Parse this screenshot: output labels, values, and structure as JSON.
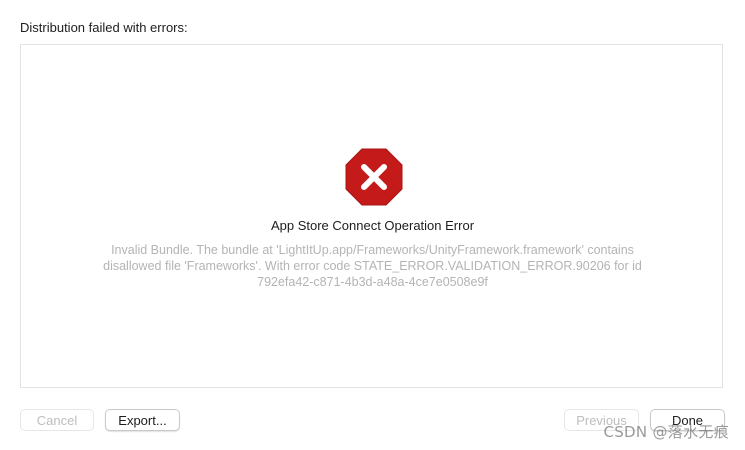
{
  "header": {
    "label": "Distribution failed with errors:"
  },
  "error": {
    "icon": "error-octagon-icon",
    "icon_color": "#c41a1a",
    "title": "App Store Connect Operation Error",
    "message": "Invalid Bundle. The bundle at 'LightItUp.app/Frameworks/UnityFramework.framework' contains disallowed file 'Frameworks'. With error code STATE_ERROR.VALIDATION_ERROR.90206 for id 792efa42-c871-4b3d-a48a-4ce7e0508e9f"
  },
  "footer": {
    "cancel_label": "Cancel",
    "export_label": "Export...",
    "previous_label": "Previous",
    "done_label": "Done"
  },
  "watermark": {
    "text": "CSDN @落水无痕"
  }
}
